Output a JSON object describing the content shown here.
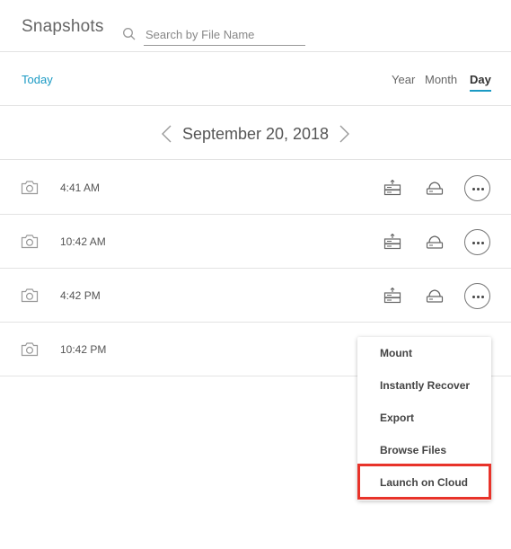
{
  "header": {
    "title": "Snapshots",
    "search_placeholder": "Search by File Name",
    "search_value": ""
  },
  "filter": {
    "today_label": "Today",
    "periods": [
      {
        "label": "Year",
        "active": false
      },
      {
        "label": "Month",
        "active": false
      },
      {
        "label": "Day",
        "active": true
      }
    ]
  },
  "date_nav": {
    "date": "September 20, 2018",
    "prev_icon": "chevron-left-icon",
    "next_icon": "chevron-right-icon"
  },
  "snapshots": [
    {
      "time": "4:41 AM",
      "icon": "camera-icon",
      "actions": [
        "server-upload-icon",
        "cloud-drive-icon",
        "more-options-icon"
      ]
    },
    {
      "time": "10:42 AM",
      "icon": "camera-icon",
      "actions": [
        "server-upload-icon",
        "cloud-drive-icon",
        "more-options-icon"
      ]
    },
    {
      "time": "4:42 PM",
      "icon": "camera-icon",
      "actions": [
        "server-upload-icon",
        "cloud-drive-icon",
        "more-options-icon"
      ]
    },
    {
      "time": "10:42 PM",
      "icon": "camera-icon",
      "actions": []
    }
  ],
  "context_menu": {
    "items": [
      {
        "label": "Mount"
      },
      {
        "label": "Instantly Recover"
      },
      {
        "label": "Export"
      },
      {
        "label": "Browse Files"
      },
      {
        "label": "Launch on Cloud",
        "highlighted": true
      }
    ]
  },
  "colors": {
    "accent": "#1b9ac4",
    "highlight": "#e8332a",
    "divider": "#e3e3e3"
  }
}
